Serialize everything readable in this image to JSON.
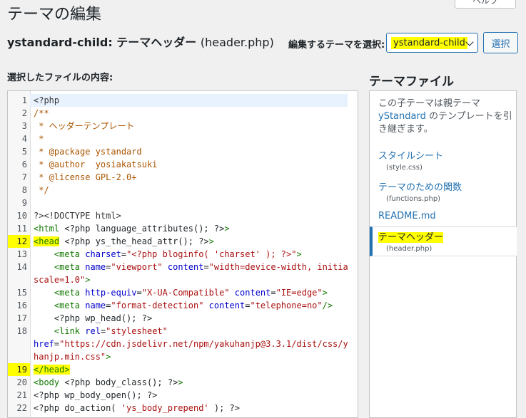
{
  "page": {
    "title": "テーマの編集",
    "help_label": "ヘルプ",
    "file_heading_theme": "ystandard-child:",
    "file_heading_name": "テーマヘッダー",
    "file_heading_file": "(header.php)",
    "select_label": "編集するテーマを選択:",
    "select_value": "ystandard-child",
    "select_button": "選択",
    "content_label": "選択したファイルの内容:"
  },
  "colors": {
    "accent": "#2271b1",
    "highlight": "#ffff00"
  },
  "editor": {
    "lines": [
      {
        "n": "1",
        "hl": false,
        "cur": true,
        "parts": [
          [
            "ph",
            "<?php"
          ]
        ]
      },
      {
        "n": "2",
        "hl": false,
        "parts": [
          [
            "cm",
            "/**"
          ]
        ]
      },
      {
        "n": "3",
        "hl": false,
        "parts": [
          [
            "cm",
            " * ヘッダーテンプレート"
          ]
        ]
      },
      {
        "n": "4",
        "hl": false,
        "parts": [
          [
            "cm",
            " *"
          ]
        ]
      },
      {
        "n": "5",
        "hl": false,
        "parts": [
          [
            "cm",
            " * @package ystandard"
          ]
        ]
      },
      {
        "n": "6",
        "hl": false,
        "parts": [
          [
            "cm",
            " * @author  yosiakatsuki"
          ]
        ]
      },
      {
        "n": "7",
        "hl": false,
        "parts": [
          [
            "cm",
            " * @license GPL-2.0+"
          ]
        ]
      },
      {
        "n": "8",
        "hl": false,
        "parts": [
          [
            "cm",
            " */"
          ]
        ]
      },
      {
        "n": "9",
        "hl": false,
        "parts": [
          [
            "pl",
            ""
          ]
        ]
      },
      {
        "n": "10",
        "hl": false,
        "parts": [
          [
            "ph",
            "?><!DOCTYPE html>"
          ]
        ]
      },
      {
        "n": "11",
        "hl": false,
        "parts": [
          [
            "tg",
            "<html"
          ],
          [
            "pl",
            " <?php language_attributes(); ?>"
          ],
          [
            "tg",
            ">"
          ]
        ]
      },
      {
        "n": "12",
        "hl": true,
        "parts": [
          [
            "tgh",
            "<head"
          ],
          [
            "pl",
            " <?php ys_the_head_attr(); ?>"
          ],
          [
            "tg",
            ">"
          ]
        ]
      },
      {
        "n": "13",
        "hl": false,
        "parts": [
          [
            "pl",
            "    "
          ],
          [
            "tg",
            "<meta"
          ],
          [
            "at",
            " charset"
          ],
          [
            "pl",
            "="
          ],
          [
            "st",
            "\"<?php bloginfo( 'charset' ); ?>\""
          ],
          [
            "tg",
            ">"
          ]
        ]
      },
      {
        "n": "14",
        "hl": false,
        "parts": [
          [
            "pl",
            "    "
          ],
          [
            "tg",
            "<meta"
          ],
          [
            "at",
            " name"
          ],
          [
            "pl",
            "="
          ],
          [
            "st",
            "\"viewport\""
          ],
          [
            "at",
            " content"
          ],
          [
            "pl",
            "="
          ],
          [
            "st",
            "\"width=device-width, initial-"
          ]
        ]
      },
      {
        "n": "",
        "hl": false,
        "parts": [
          [
            "st",
            "scale=1.0\""
          ],
          [
            "tg",
            ">"
          ]
        ]
      },
      {
        "n": "15",
        "hl": false,
        "parts": [
          [
            "pl",
            "    "
          ],
          [
            "tg",
            "<meta"
          ],
          [
            "at",
            " http-equiv"
          ],
          [
            "pl",
            "="
          ],
          [
            "st",
            "\"X-UA-Compatible\""
          ],
          [
            "at",
            " content"
          ],
          [
            "pl",
            "="
          ],
          [
            "st",
            "\"IE=edge\""
          ],
          [
            "tg",
            ">"
          ]
        ]
      },
      {
        "n": "16",
        "hl": false,
        "parts": [
          [
            "pl",
            "    "
          ],
          [
            "tg",
            "<meta"
          ],
          [
            "at",
            " name"
          ],
          [
            "pl",
            "="
          ],
          [
            "st",
            "\"format-detection\""
          ],
          [
            "at",
            " content"
          ],
          [
            "pl",
            "="
          ],
          [
            "st",
            "\"telephone=no\""
          ],
          [
            "tg",
            "/>"
          ]
        ]
      },
      {
        "n": "17",
        "hl": false,
        "parts": [
          [
            "pl",
            "    <?php wp_head(); ?>"
          ]
        ]
      },
      {
        "n": "18",
        "hl": false,
        "parts": [
          [
            "pl",
            "    "
          ],
          [
            "tg",
            "<link"
          ],
          [
            "at",
            " rel"
          ],
          [
            "pl",
            "="
          ],
          [
            "st",
            "\"stylesheet\""
          ]
        ]
      },
      {
        "n": "",
        "hl": false,
        "parts": [
          [
            "at",
            "href"
          ],
          [
            "pl",
            "="
          ],
          [
            "st",
            "\"https://cdn.jsdelivr.net/npm/yakuhanjp@3.3.1/dist/css/yaku"
          ]
        ]
      },
      {
        "n": "",
        "hl": false,
        "parts": [
          [
            "st",
            "hanjp.min.css\""
          ],
          [
            "tg",
            ">"
          ]
        ]
      },
      {
        "n": "19",
        "hl": true,
        "parts": [
          [
            "tgh",
            "</head>"
          ]
        ]
      },
      {
        "n": "20",
        "hl": false,
        "parts": [
          [
            "tg",
            "<body"
          ],
          [
            "pl",
            " <?php body_class(); ?>"
          ],
          [
            "tg",
            ">"
          ]
        ]
      },
      {
        "n": "21",
        "hl": false,
        "parts": [
          [
            "pl",
            "<?php wp_body_open(); ?>"
          ]
        ]
      },
      {
        "n": "22",
        "hl": false,
        "parts": [
          [
            "pl",
            "<?php do_action( "
          ],
          [
            "st",
            "'ys_body_prepend'"
          ],
          [
            "pl",
            " ); ?>"
          ]
        ]
      }
    ]
  },
  "sidebar": {
    "title": "テーマファイル",
    "desc_before": "この子テーマは親テーマ",
    "desc_link": "yStandard",
    "desc_after": " のテンプレートを引き継ぎます。",
    "files": [
      {
        "label": "スタイルシート",
        "file": "(style.css)"
      },
      {
        "label": "テーマのための関数",
        "file": "(functions.php)"
      },
      {
        "label": "README.md",
        "file": ""
      },
      {
        "label": "テーマヘッダー",
        "file": "(header.php)"
      }
    ]
  }
}
